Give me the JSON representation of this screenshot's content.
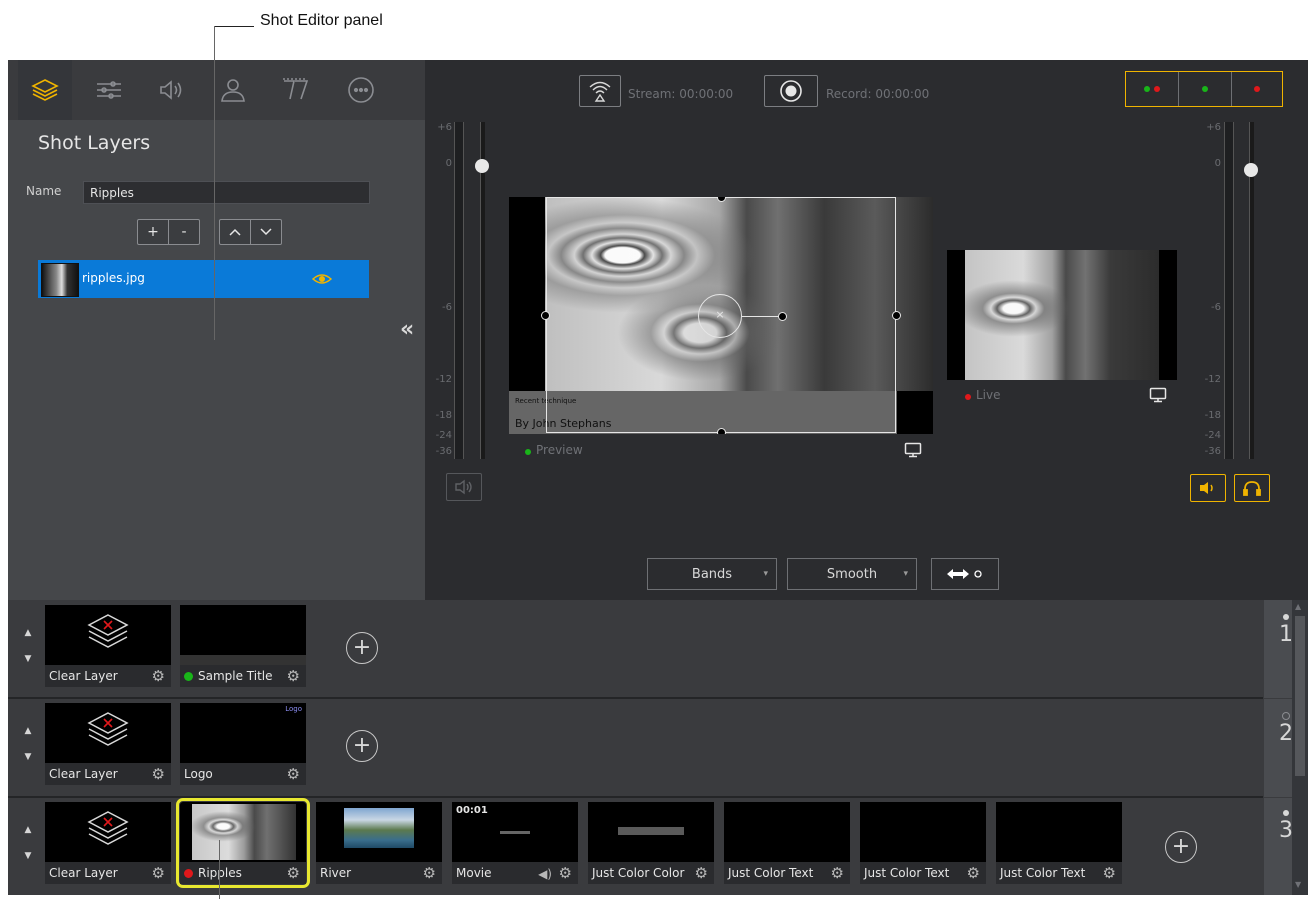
{
  "annotation_top": "Shot Editor panel",
  "shot_editor": {
    "tabs": [
      "layers",
      "settings",
      "audio",
      "person",
      "text",
      "more"
    ],
    "title": "Shot Layers",
    "name_label": "Name",
    "name_value": "Ripples",
    "btn_add": "+",
    "btn_remove": "-",
    "btn_up": "⌃",
    "btn_down": "⌄",
    "layers": [
      {
        "name": "ripples.jpg"
      }
    ],
    "collapse_icon": "«"
  },
  "toolbar": {
    "stream_label": "Stream: 00:00:00",
    "record_label": "Record: 00:00:00"
  },
  "meter_scale": [
    "+6",
    "0",
    "-6",
    "-12",
    "-18",
    "-24",
    "-36"
  ],
  "preview": {
    "label": "Preview",
    "overlay_title": "Recent technique",
    "overlay_byline": "By John Stephans"
  },
  "live": {
    "label": "Live"
  },
  "transition": {
    "effect": "Bands",
    "easing": "Smooth"
  },
  "layers": [
    {
      "number": "1",
      "shots": [
        {
          "name": "Clear Layer"
        },
        {
          "name": "Sample Title",
          "status": "green"
        }
      ]
    },
    {
      "number": "2",
      "shots": [
        {
          "name": "Clear Layer"
        },
        {
          "name": "Logo",
          "thumb_text": "Logo"
        }
      ]
    },
    {
      "number": "3",
      "shots": [
        {
          "name": "Clear Layer"
        },
        {
          "name": "Ripples",
          "status": "red"
        },
        {
          "name": "River"
        },
        {
          "name": "Movie",
          "timecode": "00:01"
        },
        {
          "name": "Just Color Color"
        },
        {
          "name": "Just Color Text"
        },
        {
          "name": "Just Color Text"
        },
        {
          "name": "Just Color Text"
        }
      ]
    }
  ],
  "colors": {
    "accent": "#f0b400",
    "selection": "#0a7ad8",
    "live_red": "#e0181b",
    "preview_green": "#19b519"
  }
}
